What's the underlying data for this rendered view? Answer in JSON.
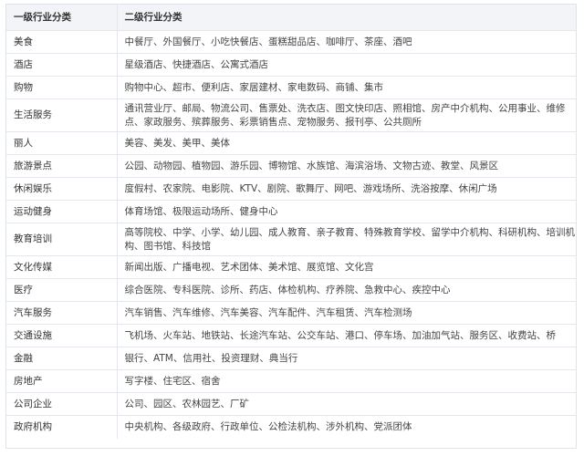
{
  "table": {
    "headers": [
      "一级行业分类",
      "二级行业分类"
    ],
    "rows": [
      {
        "primary": "美食",
        "secondary": "中餐厅、外国餐厅、小吃快餐店、蛋糕甜品店、咖啡厅、茶座、酒吧"
      },
      {
        "primary": "酒店",
        "secondary": "星级酒店、快捷酒店、公寓式酒店"
      },
      {
        "primary": "购物",
        "secondary": "购物中心、超市、便利店、家居建材、家电数码、商铺、集市"
      },
      {
        "primary": "生活服务",
        "secondary": "通讯营业厅、邮局、物流公司、售票处、洗衣店、图文快印店、照相馆、房产中介机构、公用事业、维修点、家政服务、殡葬服务、彩票销售点、宠物服务、报刊亭、公共厕所"
      },
      {
        "primary": "丽人",
        "secondary": "美容、美发、美甲、美体"
      },
      {
        "primary": "旅游景点",
        "secondary": "公园、动物园、植物园、游乐园、博物馆、水族馆、海滨浴场、文物古迹、教堂、风景区"
      },
      {
        "primary": "休闲娱乐",
        "secondary": "度假村、农家院、电影院、KTV、剧院、歌舞厅、网吧、游戏场所、洗浴按摩、休闲广场"
      },
      {
        "primary": "运动健身",
        "secondary": "体育场馆、极限运动场所、健身中心"
      },
      {
        "primary": "教育培训",
        "secondary": "高等院校、中学、小学、幼儿园、成人教育、亲子教育、特殊教育学校、留学中介机构、科研机构、培训机构、图书馆、科技馆"
      },
      {
        "primary": "文化传媒",
        "secondary": "新闻出版、广播电视、艺术团体、美术馆、展览馆、文化宫"
      },
      {
        "primary": "医疗",
        "secondary": "综合医院、专科医院、诊所、药店、体检机构、疗养院、急救中心、疾控中心"
      },
      {
        "primary": "汽车服务",
        "secondary": "汽车销售、汽车维修、汽车美容、汽车配件、汽车租赁、汽车检测场"
      },
      {
        "primary": "交通设施",
        "secondary": "飞机场、火车站、地铁站、长途汽车站、公交车站、港口、停车场、加油加气站、服务区、收费站、桥"
      },
      {
        "primary": "金融",
        "secondary": "银行、ATM、信用社、投资理财、典当行"
      },
      {
        "primary": "房地产",
        "secondary": "写字楼、住宅区、宿舍"
      },
      {
        "primary": "公司企业",
        "secondary": "公司、园区、农林园艺、厂矿"
      },
      {
        "primary": "政府机构",
        "secondary": "中央机构、各级政府、行政单位、公检法机构、涉外机构、党派团体"
      }
    ]
  }
}
